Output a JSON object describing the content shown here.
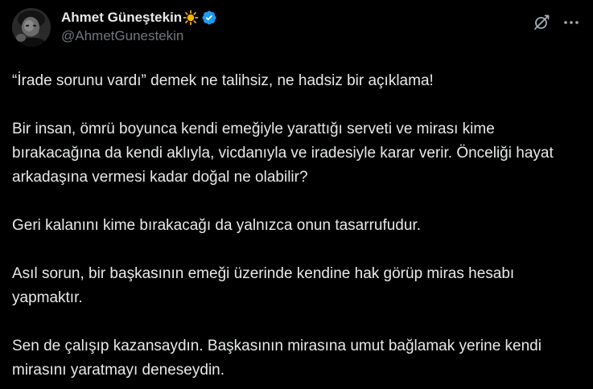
{
  "author": {
    "display_name": "Ahmet Güneştekin",
    "handle": "@AhmetGunestekin",
    "badge_icon": "sun-emoji",
    "verified": true,
    "verified_color": "#1d9bf0"
  },
  "actions": {
    "grok_icon": "grok-icon",
    "more_icon": "more-options-icon"
  },
  "tweet": {
    "paragraphs": [
      "“İrade sorunu vardı” demek ne talihsiz, ne hadsiz bir açıklama!",
      "Bir insan, ömrü boyunca kendi emeğiyle yarattığı serveti ve mirası kime bırakacağına da kendi aklıyla, vicdanıyla ve iradesiyle karar verir. Önceliği hayat arkadaşına vermesi kadar doğal ne olabilir?",
      "Geri kalanını kime bırakacağı da yalnızca onun tasarrufudur.",
      "Asıl sorun, bir başkasının emeği üzerinde kendine hak görüp miras hesabı yapmaktır.",
      "Sen de çalışıp kazansaydın. Başkasının mirasına umut bağlamak yerine kendi mirasını yaratmayı deneseydin."
    ]
  },
  "colors": {
    "background": "#000000",
    "text": "#e7e9ea",
    "secondary": "#71767b",
    "sun": "#f5b400"
  }
}
